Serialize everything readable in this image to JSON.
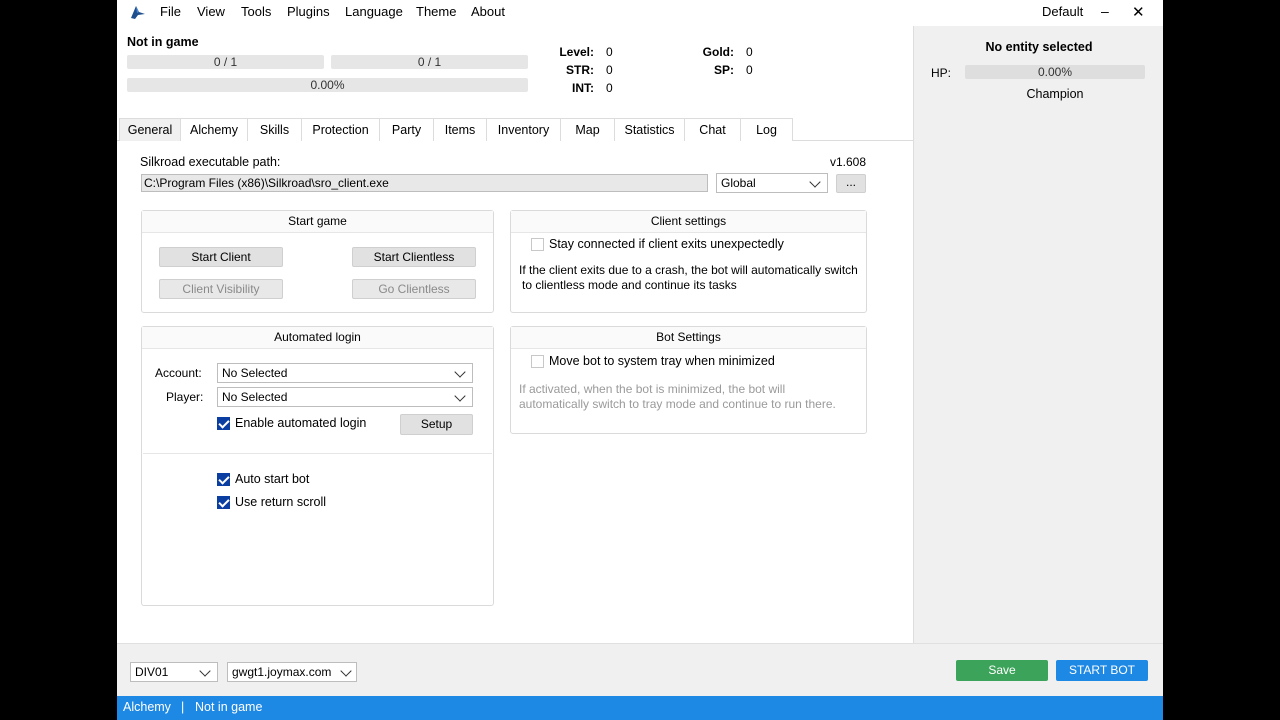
{
  "menu": {
    "items": [
      "File",
      "View",
      "Tools",
      "Plugins",
      "Language",
      "Theme",
      "About"
    ],
    "profile": "Default",
    "minimize": "‒",
    "close": "✕"
  },
  "status": {
    "game_state": "Not in game",
    "hp_bar": "0 / 1",
    "mp_bar": "0 / 1",
    "exp_bar": "0.00%"
  },
  "stats": {
    "level_label": "Level:",
    "level": "0",
    "str_label": "STR:",
    "str": "0",
    "int_label": "INT:",
    "int": "0",
    "gold_label": "Gold:",
    "gold": "0",
    "sp_label": "SP:",
    "sp": "0"
  },
  "entity": {
    "title": "No entity selected",
    "hp_label": "HP:",
    "hp_value": "0.00%",
    "type": "Champion"
  },
  "tabs": [
    "General",
    "Alchemy",
    "Skills",
    "Protection",
    "Party",
    "Items",
    "Inventory",
    "Map",
    "Statistics",
    "Chat",
    "Log"
  ],
  "general": {
    "exe_label": "Silkroad executable path:",
    "version": "v1.608",
    "exe_path": "C:\\Program Files (x86)\\Silkroad\\sro_client.exe",
    "region": "Global",
    "browse": "...",
    "start_game": {
      "title": "Start game",
      "start_client": "Start Client",
      "start_clientless": "Start Clientless",
      "client_visibility": "Client Visibility",
      "go_clientless": "Go Clientless"
    },
    "client_settings": {
      "title": "Client settings",
      "stay_connected": "Stay connected if client exits unexpectedly",
      "note_line1": "If the client exits due to a crash, the bot will automatically switch",
      "note_line2": "to clientless mode and continue its tasks"
    },
    "auto_login": {
      "title": "Automated login",
      "account_label": "Account:",
      "account_value": "No Selected",
      "player_label": "Player:",
      "player_value": "No Selected",
      "enable_label": "Enable automated login",
      "setup": "Setup",
      "auto_start": "Auto start bot",
      "return_scroll": "Use return scroll"
    },
    "bot_settings": {
      "title": "Bot Settings",
      "tray_label": "Move bot to system tray when minimized",
      "note_line1": "If activated, when the bot is minimized, the bot will",
      "note_line2": "automatically switch to tray mode and continue to run there."
    }
  },
  "bottom": {
    "division": "DIV01",
    "server": "gwgt1.joymax.com",
    "save": "Save",
    "start_bot": "START BOT"
  },
  "statusbar": {
    "plugin": "Alchemy",
    "separator": "|",
    "state": "Not in game"
  },
  "colors": {
    "accent": "#1e88e5",
    "save_green": "#3ca35a",
    "checkbox_blue": "#0a3ea1"
  }
}
